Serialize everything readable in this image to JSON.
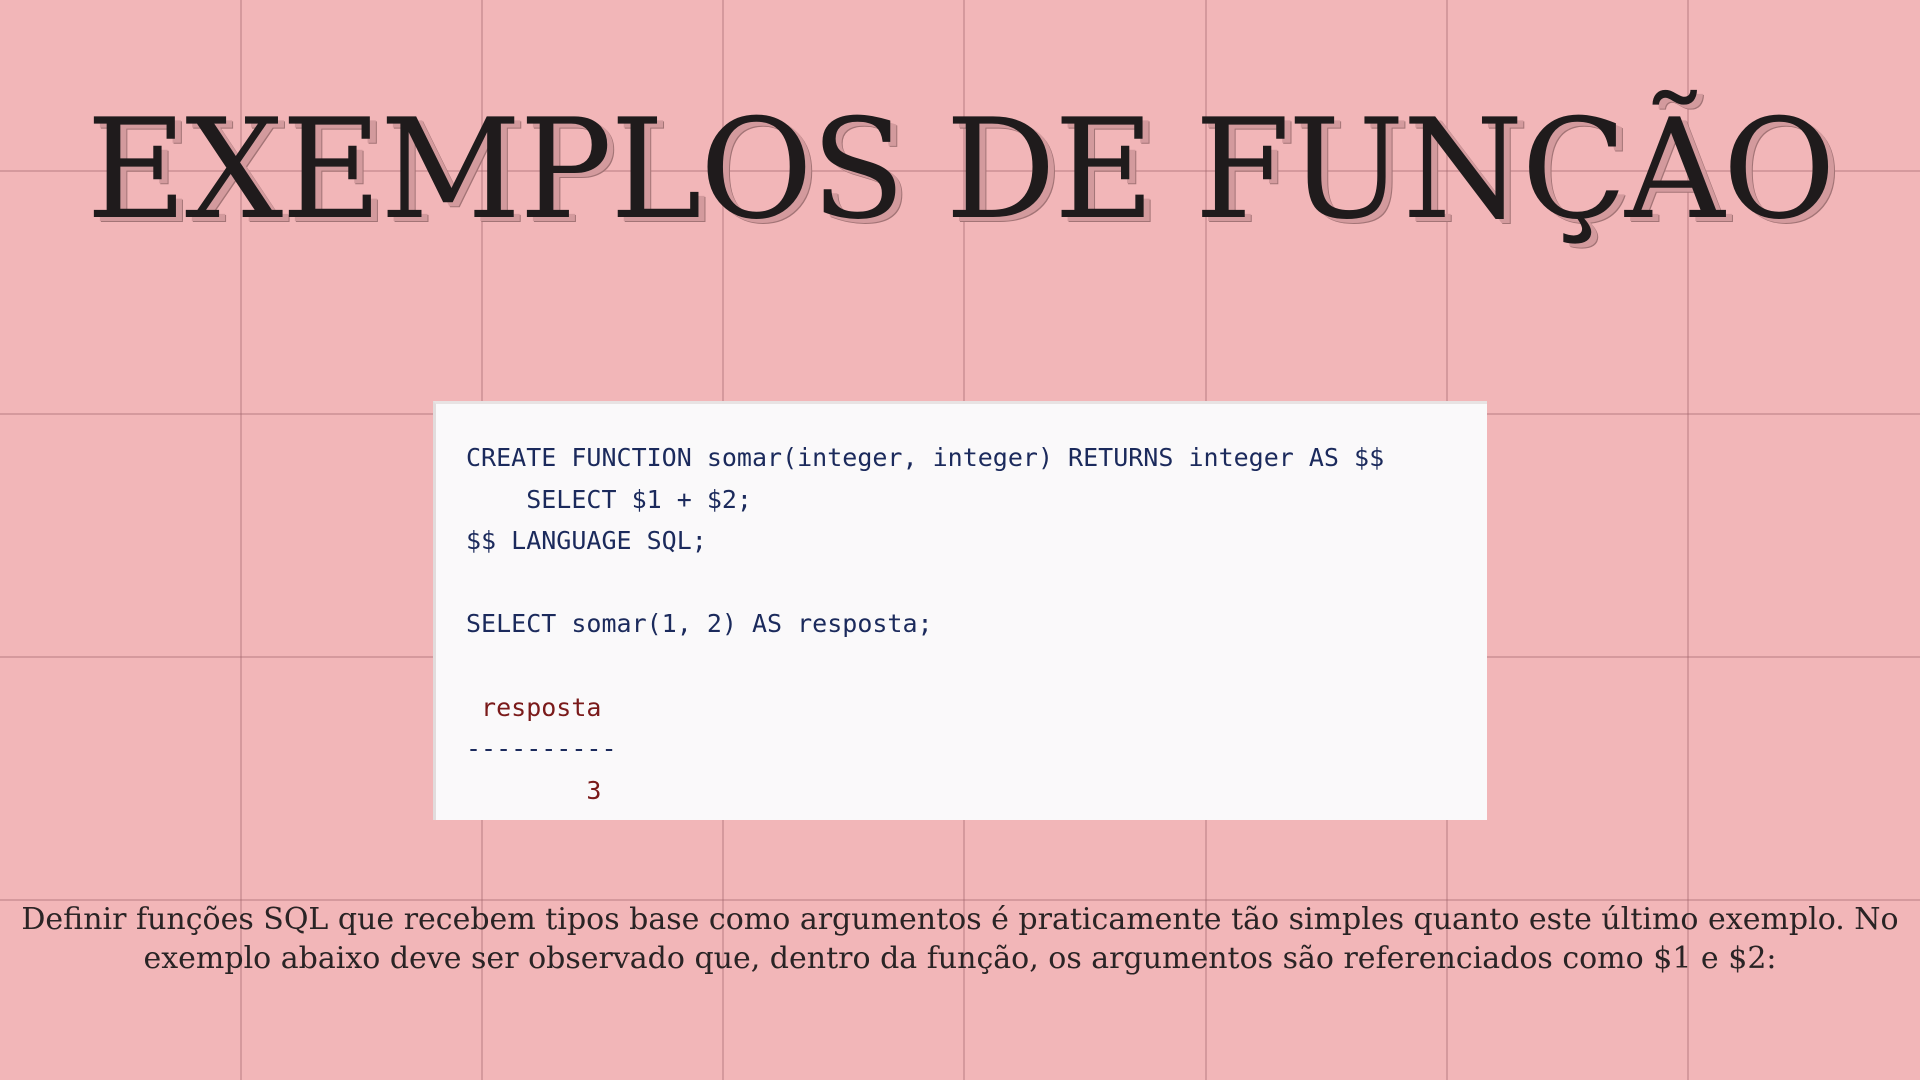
{
  "slide": {
    "title": "EXEMPLOS DE FUNÇÃO",
    "code_lines": [
      "CREATE FUNCTION somar(integer, integer) RETURNS integer AS $$",
      "    SELECT $1 + $2;",
      "$$ LANGUAGE SQL;",
      "",
      "SELECT somar(1, 2) AS resposta;",
      "",
      " resposta",
      "----------",
      "        3"
    ],
    "caption": "Definir funções SQL que recebem tipos base como argumentos é praticamente tão simples quanto este último exemplo. No exemplo abaixo deve ser observado que, dentro da função, os argumentos são referenciados como $1 e $2:"
  },
  "colors": {
    "background": "#f2b6b8",
    "title_text": "#1f1b1c",
    "code_keyword": "#1b2a5c",
    "code_result": "#7a1a1a",
    "code_background": "#faf9fa"
  }
}
